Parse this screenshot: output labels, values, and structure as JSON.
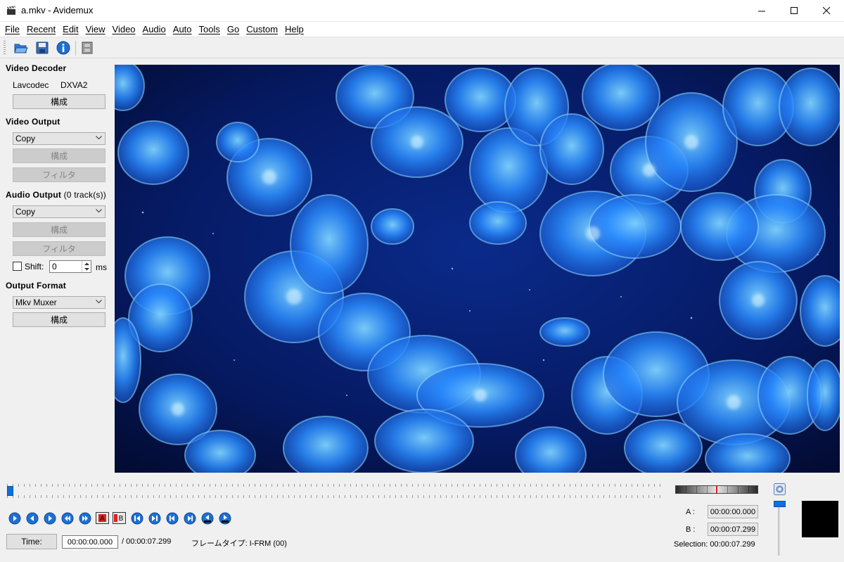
{
  "window": {
    "title": "a.mkv - Avidemux",
    "icon": "clapperboard-icon"
  },
  "menu": [
    "File",
    "Recent",
    "Edit",
    "View",
    "Video",
    "Audio",
    "Auto",
    "Tools",
    "Go",
    "Custom",
    "Help"
  ],
  "toolbar": {
    "icons": [
      "open-folder-icon",
      "save-disk-icon",
      "info-icon",
      "film-strip-icon"
    ]
  },
  "video_decoder": {
    "title": "Video Decoder",
    "codec": "Lavcodec",
    "hw": "DXVA2",
    "configure_label": "構成"
  },
  "video_output": {
    "title": "Video Output",
    "codec": "Copy",
    "configure_label": "構成",
    "filter_label": "フィルタ"
  },
  "audio_output": {
    "title": "Audio Output",
    "tracks": "(0 track(s))",
    "codec": "Copy",
    "configure_label": "構成",
    "filter_label": "フィルタ",
    "shift_label": "Shift:",
    "shift_value": "0",
    "shift_unit": "ms"
  },
  "output_format": {
    "title": "Output Format",
    "muxer": "Mkv Muxer",
    "configure_label": "構成"
  },
  "playback": {
    "position": 0,
    "time_button": "Time:",
    "current_time": "00:00:00.000",
    "total_time": "/ 00:00:07.299",
    "frame_type": "フレームタイプ: I-FRM (00)"
  },
  "selection": {
    "a_label": "A :",
    "a_value": "00:00:00.000",
    "b_label": "B :",
    "b_value": "00:00:07.299",
    "selection_text": "Selection: 00:00:07.299"
  },
  "colors": {
    "accent": "#0f6fe0",
    "video_bg": "#03103a",
    "jelly": "#2c8bff"
  }
}
